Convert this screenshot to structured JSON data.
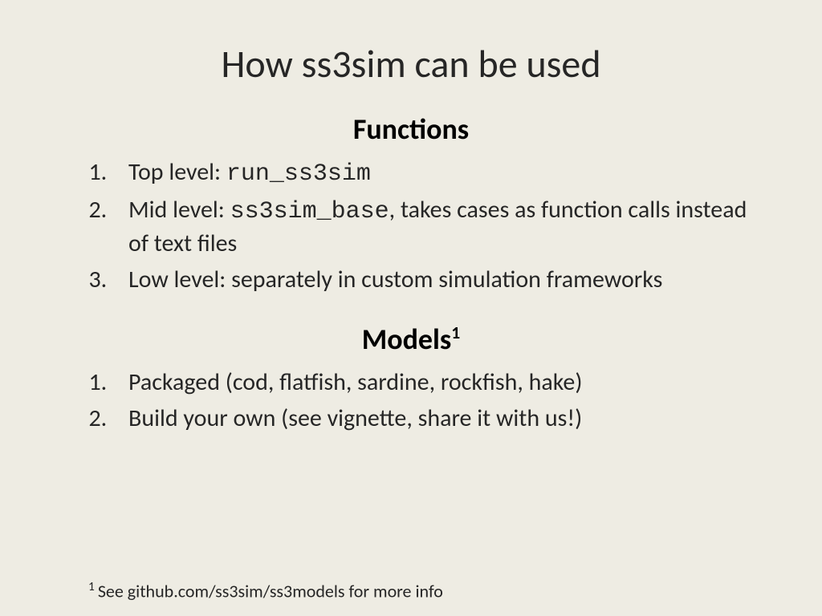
{
  "title": "How ss3sim can be used",
  "sections": {
    "functions": {
      "heading": "Functions",
      "items": [
        {
          "prefix": "Top level: ",
          "code": "run_ss3sim",
          "suffix": ""
        },
        {
          "prefix": "Mid level: ",
          "code": "ss3sim_base",
          "suffix": ", takes cases as function calls instead of text files"
        },
        {
          "prefix": "Low level: separately in custom simulation frameworks",
          "code": "",
          "suffix": ""
        }
      ]
    },
    "models": {
      "heading": "Models",
      "heading_sup": "1",
      "items": [
        {
          "text": "Packaged (cod, flatfish, sardine, rockfish, hake)"
        },
        {
          "text": "Build your own (see vignette, share it with us!)"
        }
      ]
    }
  },
  "footnote": {
    "sup": "1",
    "text": "See github.com/ss3sim/ss3models for more info"
  }
}
